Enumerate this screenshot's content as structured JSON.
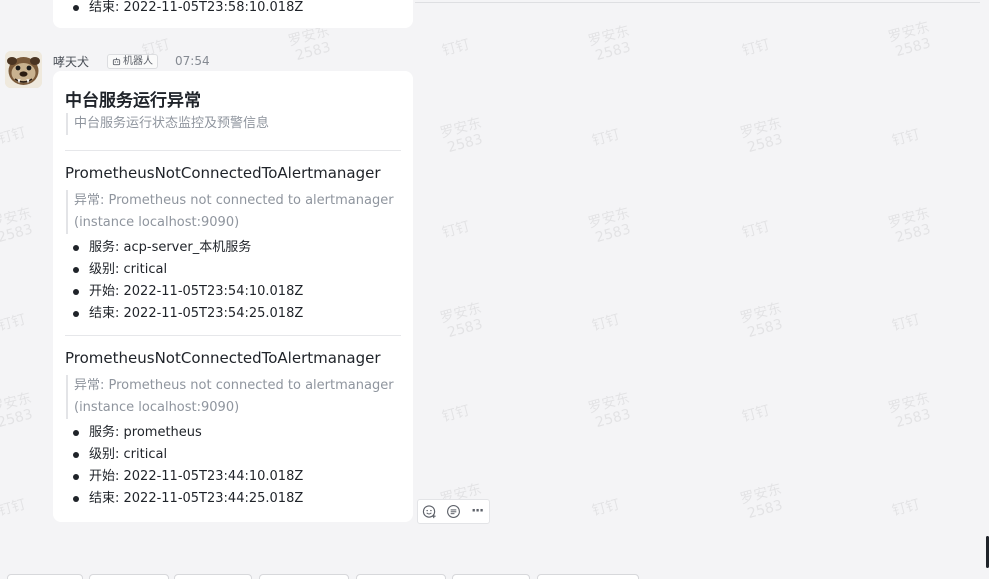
{
  "watermark": {
    "name": "罗安东",
    "id": "2583",
    "app": "钉钉"
  },
  "previous_message": {
    "last_item": "结束: 2022-11-05T23:58:10.018Z"
  },
  "message": {
    "sender": "哮天犬",
    "robot_tag": "机器人",
    "time": "07:54"
  },
  "card": {
    "title": "中台服务运行异常",
    "subtitle": "中台服务运行状态监控及预警信息",
    "alerts": [
      {
        "name": "PrometheusNotConnectedToAlertmanager",
        "description": "异常: Prometheus not connected to alertmanager (instance localhost:9090)",
        "items": [
          "服务: acp-server_本机服务",
          "级别: critical",
          "开始: 2022-11-05T23:54:10.018Z",
          "结束: 2022-11-05T23:54:25.018Z"
        ]
      },
      {
        "name": "PrometheusNotConnectedToAlertmanager",
        "description": "异常: Prometheus not connected to alertmanager (instance localhost:9090)",
        "items": [
          "服务: prometheus",
          "级别: critical",
          "开始: 2022-11-05T23:44:10.018Z",
          "结束: 2022-11-05T23:44:25.018Z"
        ]
      }
    ]
  },
  "actions": {
    "icons": [
      "emoji-reaction-icon",
      "reply-icon",
      "more-icon"
    ],
    "more_label": "···"
  },
  "colors": {
    "background": "#f4f4f6",
    "card": "#ffffff",
    "text": "#1f2329",
    "muted": "#8f959e"
  }
}
